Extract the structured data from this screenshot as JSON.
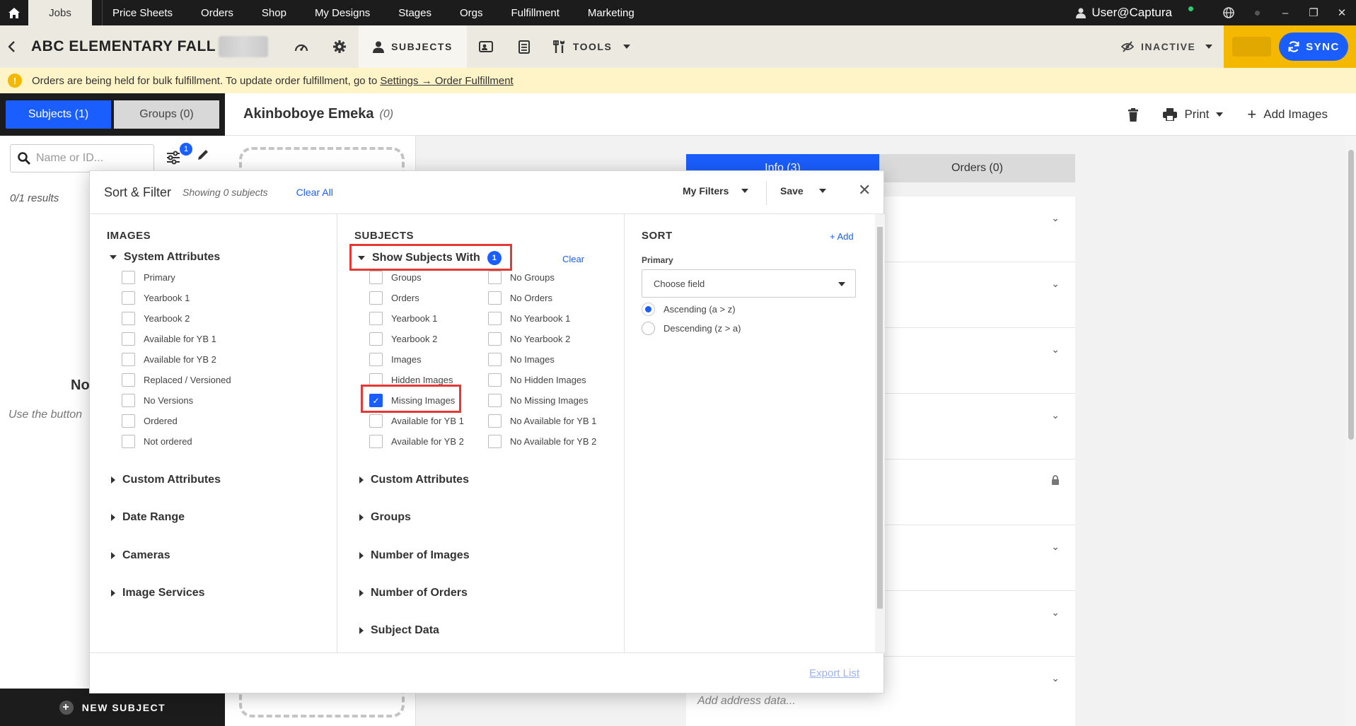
{
  "topnav": {
    "tabs": [
      "Jobs",
      "Price Sheets",
      "Orders",
      "Shop",
      "My Designs",
      "Stages",
      "Orgs",
      "Fulfillment",
      "Marketing"
    ],
    "user": "User@Captura"
  },
  "jobbar": {
    "title": "ABC ELEMENTARY FALL",
    "subjects_tab": "SUBJECTS",
    "tools": "TOOLS",
    "status": "INACTIVE",
    "sync": "SYNC"
  },
  "banner": {
    "text": "Orders are being held for bulk fulfillment. To update order fulfillment, go to",
    "link": "Settings → Order Fulfillment"
  },
  "left": {
    "tab_subjects": "Subjects (1)",
    "tab_groups": "Groups (0)",
    "search_placeholder": "Name or ID...",
    "filter_badge": "1",
    "results": "0/1 results",
    "no_text": "No",
    "use_text": "Use the button",
    "new_subject": "NEW SUBJECT"
  },
  "center": {
    "subject_name": "Akinboboye Emeka",
    "subject_count": "(0)",
    "print": "Print",
    "add_images": "Add Images",
    "tab_info": "Info (3)",
    "tab_orders": "Orders (0)",
    "address_placeholder": "Add address data..."
  },
  "modal": {
    "title": "Sort & Filter",
    "showing": "Showing 0 subjects",
    "clear_all": "Clear All",
    "my_filters": "My Filters",
    "save": "Save",
    "images": {
      "heading": "IMAGES",
      "system_attributes": "System Attributes",
      "items": [
        "Primary",
        "Yearbook 1",
        "Yearbook 2",
        "Available for YB 1",
        "Available for YB 2",
        "Replaced / Versioned",
        "No Versions",
        "Ordered",
        "Not ordered"
      ],
      "sections": [
        "Custom Attributes",
        "Date Range",
        "Cameras",
        "Image Services"
      ]
    },
    "subjects": {
      "heading": "SUBJECTS",
      "show_with": "Show Subjects With",
      "badge": "1",
      "clear": "Clear",
      "left_items": [
        "Groups",
        "Orders",
        "Yearbook 1",
        "Yearbook 2",
        "Images",
        "Hidden Images",
        "Missing Images",
        "Available for YB 1",
        "Available for YB 2"
      ],
      "right_items": [
        "No Groups",
        "No Orders",
        "No Yearbook 1",
        "No Yearbook 2",
        "No Images",
        "No Hidden Images",
        "No Missing Images",
        "No Available for YB 1",
        "No Available for YB 2"
      ],
      "checked_item": "Missing Images",
      "sections": [
        "Custom Attributes",
        "Groups",
        "Number of Images",
        "Number of Orders",
        "Subject Data"
      ]
    },
    "sort": {
      "heading": "SORT",
      "add": "+ Add",
      "primary_label": "Primary",
      "choose_field": "Choose field",
      "ascending": "Ascending (a > z)",
      "descending": "Descending (z > a)"
    },
    "export": "Export List"
  },
  "colors": {
    "accent": "#1a5eff",
    "highlight": "#e53935",
    "banner": "#fff3c8",
    "sync_bg": "#f5b800"
  }
}
